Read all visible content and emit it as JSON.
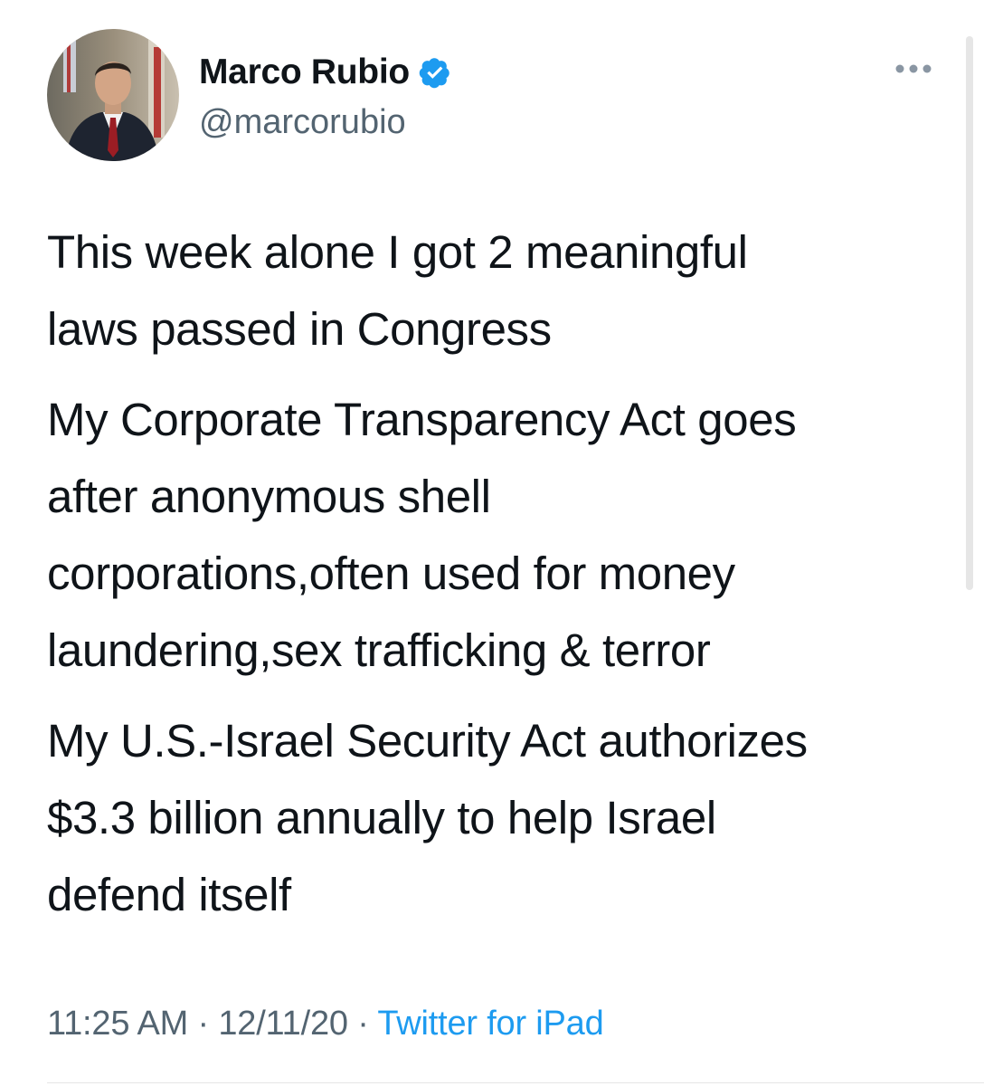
{
  "author": {
    "display_name": "Marco Rubio",
    "handle": "@marcorubio",
    "verified": true,
    "avatar_icon": "profile-photo",
    "verified_icon": "verified-badge-icon"
  },
  "more_icon": "more-options-icon",
  "tweet": {
    "paragraphs": [
      "This week alone I got 2 meaningful\nlaws passed in Congress",
      "My Corporate Transparency Act goes\nafter anonymous shell\ncorporations,often used for money\nlaundering,sex trafficking & terror",
      "My U.S.-Israel Security Act authorizes\n$3.3 billion annually to help Israel\ndefend itself"
    ]
  },
  "meta": {
    "time": "11:25 AM",
    "separator": "·",
    "date": "12/11/20",
    "source": "Twitter for iPad"
  },
  "colors": {
    "text": "#0f1419",
    "secondary": "#536471",
    "link": "#1d9bf0",
    "verified": "#1d9bf0"
  }
}
